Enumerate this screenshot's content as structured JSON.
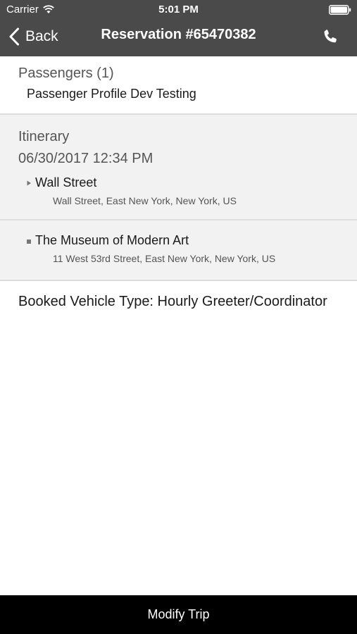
{
  "status_bar": {
    "carrier": "Carrier",
    "time": "5:01 PM",
    "icons": [
      "wifi-icon",
      "battery-icon"
    ]
  },
  "nav": {
    "back_label": "Back",
    "title": "Reservation #65470382",
    "icons": [
      "chevron-left-icon",
      "phone-icon"
    ]
  },
  "passengers": {
    "heading": "Passengers (1)",
    "items": [
      {
        "name": "Passenger Profile Dev Testing"
      }
    ]
  },
  "itinerary": {
    "heading": "Itinerary",
    "datetime": "06/30/2017 12:34 PM",
    "stops": [
      {
        "name": "Wall Street",
        "address": "Wall Street, East New York, New York, US",
        "marker": "triangle-marker-icon"
      },
      {
        "name": "The Museum of Modern Art",
        "address": "11 West 53rd Street, East New York, New York, US",
        "marker": "square-marker-icon"
      }
    ]
  },
  "vehicle": {
    "label": "Booked Vehicle Type: Hourly Greeter/Coordinator"
  },
  "footer": {
    "modify_label": "Modify Trip"
  },
  "colors": {
    "header_bg": "#4a4a4a",
    "itinerary_bg": "#f2f2f2",
    "footer_bg": "#000000"
  }
}
